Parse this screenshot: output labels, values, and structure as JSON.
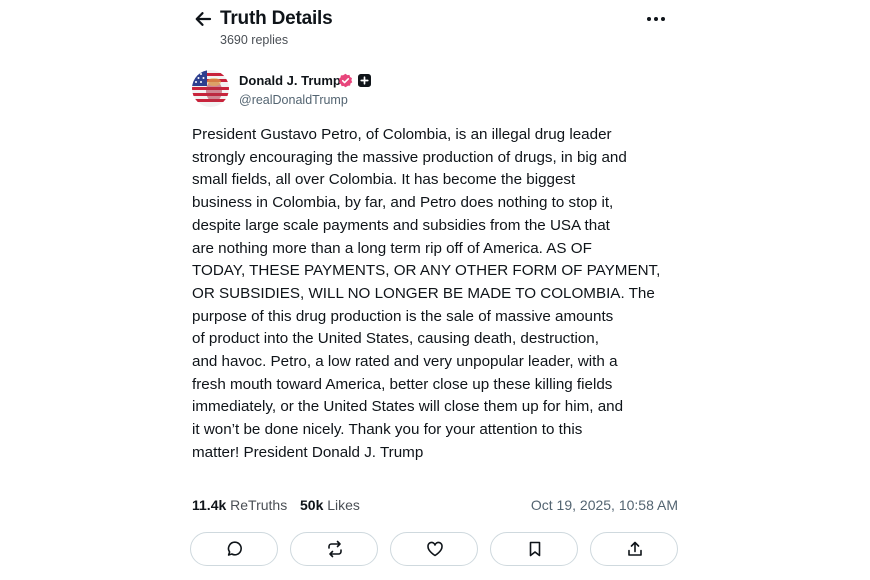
{
  "header": {
    "title": "Truth Details",
    "replies": "3690 replies"
  },
  "post": {
    "author": {
      "display_name": "Donald J. Trump",
      "handle": "@realDonaldTrump"
    },
    "body": "President Gustavo Petro, of Colombia, is an illegal drug leader\nstrongly encouraging the massive production of drugs, in big and\nsmall fields, all over Colombia. It has become the biggest\nbusiness in Colombia, by far, and Petro does nothing to stop it,\ndespite large scale payments and subsidies from the USA that\nare nothing more than a long term rip off of America. AS OF\nTODAY, THESE PAYMENTS, OR ANY OTHER FORM OF PAYMENT,\nOR SUBSIDIES, WILL NO LONGER BE MADE TO COLOMBIA. The\npurpose of this drug production is the sale of massive amounts\nof product into the United States, causing death, destruction,\nand havoc. Petro, a low rated and very unpopular leader, with a\nfresh mouth toward America, better close up these killing fields\nimmediately, or the United States will close them up for him, and\nit won’t be done nicely. Thank you for your attention to this\nmatter! President Donald J. Trump",
    "stats": {
      "retruths_count": "11.4k",
      "retruths_label": "ReTruths",
      "likes_count": "50k",
      "likes_label": "Likes"
    },
    "timestamp": "Oct 19, 2025, 10:58 AM"
  },
  "icons": {
    "back": "arrow-left-icon",
    "more": "more-horizontal-icon",
    "verified": "verified-badge-icon",
    "plus": "plus-square-icon",
    "reply": "chat-bubble-icon",
    "retruth": "repost-icon",
    "like": "heart-icon",
    "bookmark": "bookmark-icon",
    "share": "share-upload-icon"
  },
  "colors": {
    "text": "#0f1419",
    "muted": "#536471",
    "border": "#cfd9de",
    "verified": "#e8467c"
  }
}
